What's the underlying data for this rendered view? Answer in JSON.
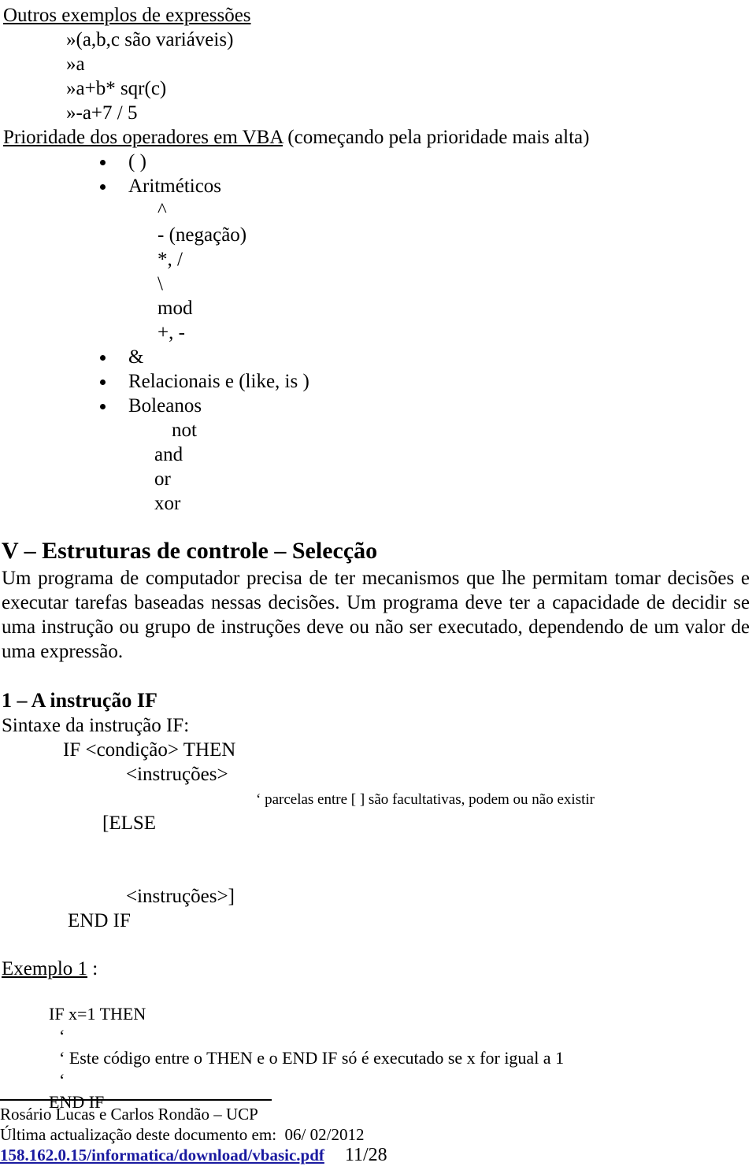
{
  "document": {
    "expressions_section": {
      "title": "Outros exemplos de expressões",
      "items": [
        "»(a,b,c são variáveis)",
        "»a",
        "»a+b* sqr(c)",
        "»-a+7 / 5"
      ]
    },
    "priority_section": {
      "title": "Prioridade dos operadores em VBA",
      "title_note": " (começando pela prioridade mais alta)",
      "bullets": [
        {
          "label": "( )"
        },
        {
          "label": "Aritméticos",
          "sub": [
            "^",
            "- (negação)",
            "*, /",
            "\\",
            "mod",
            "+, -"
          ]
        },
        {
          "label": "&"
        },
        {
          "label": "Relacionais e (like, is )"
        },
        {
          "label": "Boleanos",
          "sub": [
            "not",
            "and",
            "or",
            "xor"
          ]
        }
      ]
    },
    "control_section": {
      "heading": "V – Estruturas de controle – Selecção",
      "paragraph": "Um programa de computador precisa de ter mecanismos que lhe permitam tomar decisões e executar tarefas baseadas nessas decisões. Um programa deve ter a capacidade de decidir se uma instrução ou grupo de instruções deve ou não ser executado, dependendo de um valor de uma expressão."
    },
    "if_section": {
      "heading": "1 – A instrução IF",
      "intro": "Sintaxe da instrução IF:",
      "syntax_lines": [
        "IF <condição> THEN",
        "<instruções>",
        "[ELSE",
        "<instruções>]",
        "END IF"
      ],
      "note": "‘ parcelas entre [ ] são facultativas, podem ou não existir"
    },
    "example_section": {
      "title": "Exemplo 1",
      "title_suffix": " :",
      "code_lines": [
        "IF x=1 THEN",
        "‘",
        "‘ Este código entre o THEN e o END IF só é executado se x for igual a 1",
        "‘",
        "END IF"
      ]
    },
    "footer": {
      "authors": "Rosário Lucas e Carlos Rondão – UCP",
      "updated": "Última actualização deste documento em:  06/ 02/2012",
      "url": "158.162.0.15/informatica/download/vbasic.pdf",
      "page": "11/28"
    }
  },
  "colors": {
    "text": "#000000",
    "link": "#1a1aa0",
    "background": "#ffffff"
  }
}
